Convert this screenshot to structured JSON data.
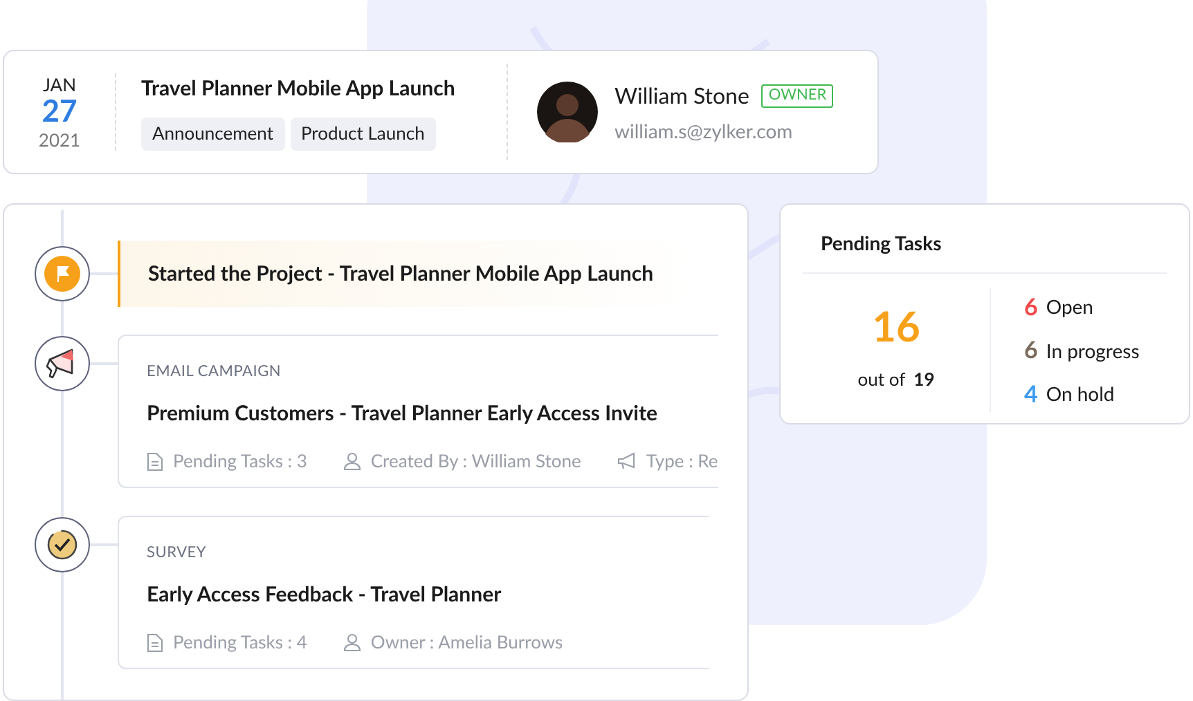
{
  "event": {
    "month": "JAN",
    "day": "27",
    "year": "2021",
    "title": "Travel Planner Mobile App Launch",
    "tags": [
      "Announcement",
      "Product Launch"
    ],
    "owner": {
      "name": "William Stone",
      "badge": "OWNER",
      "email": "william.s@zylker.com"
    }
  },
  "timeline": [
    {
      "kind": "milestone",
      "title": "Started the Project - Travel Planner Mobile App Launch"
    },
    {
      "kind": "card",
      "category": "EMAIL CAMPAIGN",
      "title": "Premium Customers - Travel Planner Early Access Invite",
      "meta": [
        "Pending Tasks : 3",
        "Created By : William Stone",
        "Type : Re"
      ]
    },
    {
      "kind": "card",
      "category": "SURVEY",
      "title": "Early Access Feedback - Travel Planner",
      "meta": [
        "Pending Tasks : 4",
        "Owner : Amelia Burrows"
      ]
    }
  ],
  "pending": {
    "title": "Pending Tasks",
    "done": "16",
    "out_of_label": "out of",
    "total": "19",
    "statuses": [
      {
        "count": "6",
        "label": "Open",
        "color": "#f0494b"
      },
      {
        "count": "6",
        "label": "In progress",
        "color": "#7b6b5b"
      },
      {
        "count": "4",
        "label": "On hold",
        "color": "#3d9bf0"
      }
    ]
  }
}
